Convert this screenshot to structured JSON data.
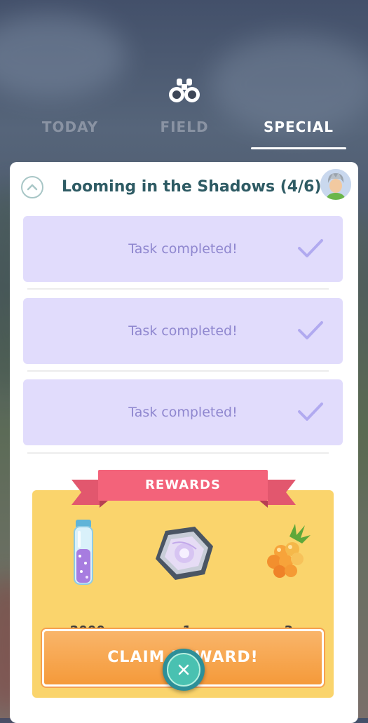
{
  "tabs": [
    {
      "label": "TODAY",
      "active": false
    },
    {
      "label": "FIELD",
      "active": false
    },
    {
      "label": "SPECIAL",
      "active": true
    }
  ],
  "research": {
    "title": "Looming in the Shadows (4/6)",
    "tasks": [
      {
        "label": "Task completed!",
        "done": true
      },
      {
        "label": "Task completed!",
        "done": true
      },
      {
        "label": "Task completed!",
        "done": true
      }
    ]
  },
  "rewards": {
    "header": "REWARDS",
    "items": [
      {
        "icon": "stardust-vial-icon",
        "quantity": "x2000"
      },
      {
        "icon": "rocket-radar-icon",
        "quantity": "x1"
      },
      {
        "icon": "golden-razz-berry-icon",
        "quantity": "x3"
      }
    ],
    "claim_label": "CLAIM REWARD!"
  },
  "colors": {
    "task_bg": "#e1dcfc",
    "task_text": "#8f87cf",
    "rewards_bg": "#fad46c",
    "ribbon": "#f3637a",
    "claim_button": "#f59a3a",
    "title": "#2e5b64",
    "close_button": "#49c1b1"
  }
}
